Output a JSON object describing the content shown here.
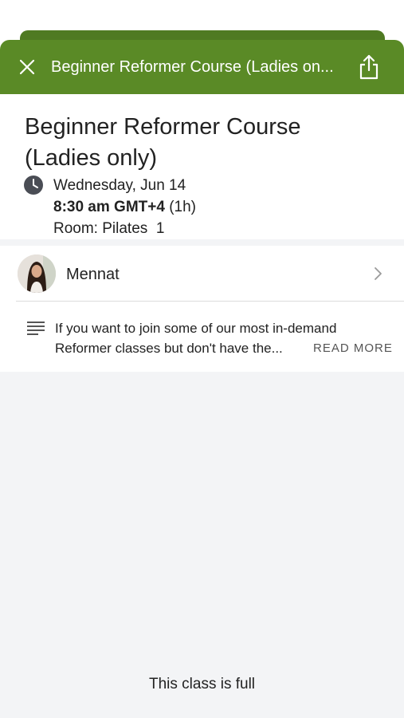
{
  "header": {
    "title": "Beginner Reformer Course (Ladies on...",
    "background_color": "#5a8a26",
    "close_icon": "close-icon",
    "share_icon": "share-icon"
  },
  "class_info": {
    "title": "Beginner Reformer Course (Ladies only)",
    "date": "Wednesday, Jun 14",
    "time": "8:30 am GMT+4",
    "duration": "(1h)",
    "room": "Room: Pilates  1"
  },
  "instructor": {
    "name": "Mennat"
  },
  "description": {
    "text": "If you want to join some of our most in-demand Reformer classes but don't have the...",
    "read_more_label": "READ MORE"
  },
  "footer": {
    "status_text": "This class is full"
  }
}
